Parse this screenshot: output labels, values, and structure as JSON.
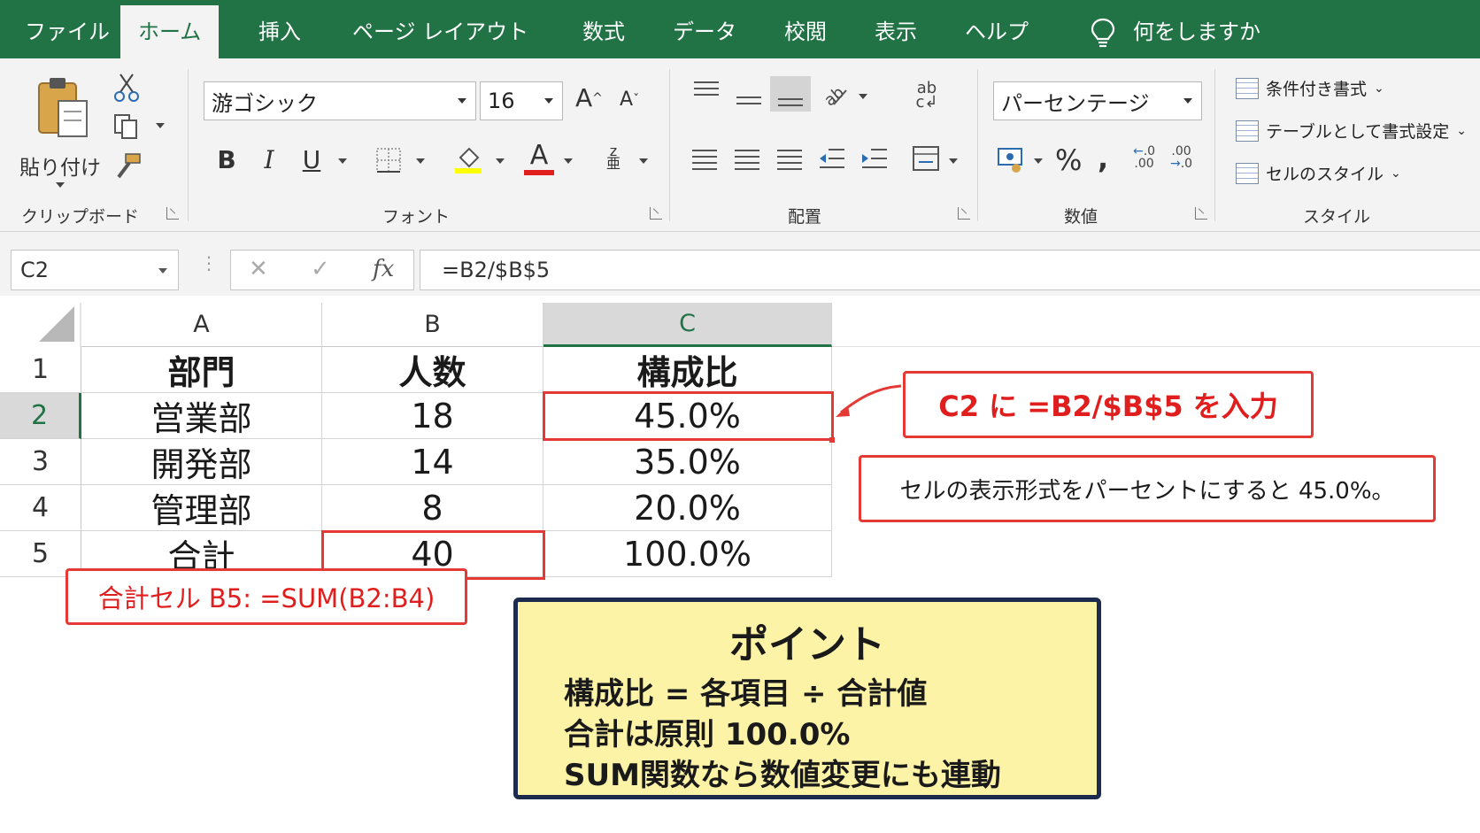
{
  "tabs": [
    {
      "label": "ファイル"
    },
    {
      "label": "ホーム"
    },
    {
      "label": "挿入"
    },
    {
      "label": "ページ レイアウト"
    },
    {
      "label": "数式"
    },
    {
      "label": "データ"
    },
    {
      "label": "校閲"
    },
    {
      "label": "表示"
    },
    {
      "label": "ヘルプ"
    }
  ],
  "active_tab": "ホーム",
  "tellme": {
    "label": "何をしますか",
    "icon": "lightbulb-icon"
  },
  "ribbon": {
    "clipboard": {
      "paste_label": "貼り付け",
      "group_label": "クリップボード"
    },
    "font": {
      "name": "游ゴシック",
      "size": "16",
      "group_label": "フォント",
      "bold": "B",
      "italic": "I",
      "underline": "U",
      "font_color": "#e01e1e",
      "fill_color": "#ffff00"
    },
    "alignment": {
      "group_label": "配置"
    },
    "number": {
      "format": "パーセンテージ",
      "percent": "%",
      "comma": ",",
      "group_label": "数値"
    },
    "styles": {
      "conditional": "条件付き書式",
      "table": "テーブルとして書式設定",
      "cell_styles": "セルのスタイル",
      "group_label": "スタイル"
    }
  },
  "formula_bar": {
    "name_box": "C2",
    "fx": "fx",
    "formula": "=B2/$B$5"
  },
  "sheet": {
    "columns": [
      "A",
      "B",
      "C"
    ],
    "selected_column": "C",
    "selected_row": "2",
    "rows": [
      {
        "num": "1",
        "cells": [
          "部門",
          "人数",
          "構成比"
        ]
      },
      {
        "num": "2",
        "cells": [
          "営業部",
          "18",
          "45.0%"
        ]
      },
      {
        "num": "3",
        "cells": [
          "開発部",
          "14",
          "35.0%"
        ]
      },
      {
        "num": "4",
        "cells": [
          "管理部",
          "8",
          "20.0%"
        ]
      },
      {
        "num": "5",
        "cells": [
          "合計",
          "40",
          "100.0%"
        ]
      }
    ]
  },
  "callouts": {
    "c2_input": "C2 に =B2/$B$5 を入力",
    "format_note": "セルの表示形式をパーセントにすると 45.0%。",
    "sum_note": "合計セル B5: =SUM(B2:B4)"
  },
  "point": {
    "title": "ポイント",
    "lines": [
      "構成比 = 各項目 ÷ 合計値",
      "合計は原則 100.0%",
      "SUM関数なら数値変更にも連動"
    ]
  },
  "colors": {
    "excel_green": "#217346",
    "callout_red": "#e53935",
    "point_bg": "#fdf3a7",
    "point_border": "#1c2b4d"
  }
}
